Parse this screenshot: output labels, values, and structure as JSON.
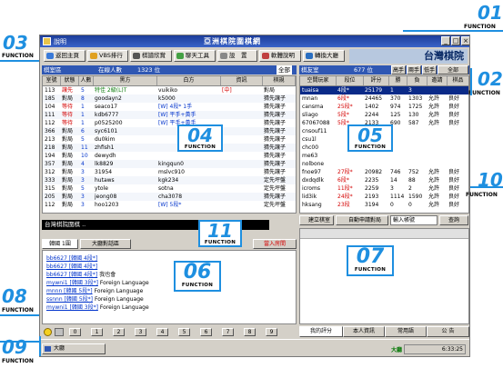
{
  "window": {
    "app_label": "說明",
    "title": "亞洲棋院圍棋網",
    "controls": [
      "_",
      "□",
      "×"
    ]
  },
  "toolbar": {
    "buttons": [
      "返回主頁",
      "VBS排行",
      "棋譜欣賞",
      "聊天工具",
      "設　置",
      "軟體說明",
      "轉換大廳"
    ],
    "logo_text": "台灣棋院"
  },
  "games": {
    "header_label": "棋室區",
    "online_label": "在線人數",
    "online_count": "1323 位",
    "filter_label": "全部",
    "columns": [
      "室號",
      "狀態",
      "人數",
      "黑方",
      "",
      "白方",
      "",
      "資訊",
      "棋規"
    ],
    "rows": [
      {
        "room": "113",
        "status": "讓先",
        "count": "5",
        "black": "特佳 2級(L)T",
        "white": "vuikiko",
        "info": "[中]",
        "rule": "對局"
      },
      {
        "room": "185",
        "status": "對局",
        "count": "8",
        "black": "goodayn2",
        "white": "k5000",
        "info": "",
        "rule": "猜先讓子"
      },
      {
        "room": "104",
        "status": "等待",
        "count": "1",
        "black": "seaco17",
        "white": "[W] 4段* 1手",
        "info": "",
        "rule": "猜先讓子"
      },
      {
        "room": "111",
        "status": "等待",
        "count": "1",
        "black": "kdb6777",
        "white": "[W] 平手+黃手",
        "info": "",
        "rule": "猜先讓子"
      },
      {
        "room": "112",
        "status": "等待",
        "count": "1",
        "black": "p0525200",
        "white": "[W] 平手+黃手",
        "info": "",
        "rule": "猜先讓子"
      },
      {
        "room": "366",
        "status": "對局",
        "count": "6",
        "black": "syc6101",
        "white": "",
        "info": "",
        "rule": "猜先讓子"
      },
      {
        "room": "213",
        "status": "對局",
        "count": "5",
        "black": "du0kim",
        "white": "",
        "info": "",
        "rule": "猜先讓子"
      },
      {
        "room": "218",
        "status": "對局",
        "count": "11",
        "black": "zhfish1",
        "white": "",
        "info": "",
        "rule": "猜先讓子"
      },
      {
        "room": "194",
        "status": "對局",
        "count": "10",
        "black": "dewydh",
        "white": "",
        "info": "",
        "rule": "猜先讓子"
      },
      {
        "room": "357",
        "status": "對局",
        "count": "4",
        "black": "lk8829",
        "white": "kingqun0",
        "info": "",
        "rule": "猜先讓子"
      },
      {
        "room": "312",
        "status": "對局",
        "count": "3",
        "black": "31954",
        "white": "mslvc910",
        "info": "",
        "rule": "猜先讓子"
      },
      {
        "room": "333",
        "status": "對局",
        "count": "3",
        "black": "hutaws",
        "white": "kgk234",
        "info": "",
        "rule": "定先坪盤"
      },
      {
        "room": "315",
        "status": "對局",
        "count": "5",
        "black": "ytole",
        "white": "sotna",
        "info": "",
        "rule": "定先坪盤"
      },
      {
        "room": "205",
        "status": "對局",
        "count": "3",
        "black": "jeong08",
        "white": "cha3078",
        "info": "",
        "rule": "猜先讓子"
      },
      {
        "room": "112",
        "status": "對局",
        "count": "3",
        "black": "hoo1203",
        "white": "[W] 5段*",
        "info": "",
        "rule": "定先坪盤"
      }
    ]
  },
  "players": {
    "header_label": "棋友室",
    "online_count": "677 位",
    "filter_label": "全部",
    "subtabs": [
      "高手",
      "兩手",
      "低手"
    ],
    "columns": [
      "空間玩家",
      "段位",
      "評分",
      "勝",
      "負",
      "邀請",
      "棋品"
    ],
    "rows": [
      {
        "name": "tuaisa",
        "rank": "4段*",
        "score": "25179",
        "win": "1",
        "loss": "3",
        "invite": "",
        "grade": ""
      },
      {
        "name": "mnan",
        "rank": "6段*",
        "score": "24465",
        "win": "370",
        "loss": "1303",
        "invite": "允許",
        "grade": "良好"
      },
      {
        "name": "cansma",
        "rank": "25段*",
        "score": "1402",
        "win": "974",
        "loss": "1725",
        "invite": "允許",
        "grade": "良好"
      },
      {
        "name": "sliago",
        "rank": "5段*",
        "score": "2244",
        "win": "125",
        "loss": "130",
        "invite": "允許",
        "grade": "良好"
      },
      {
        "name": "67067088",
        "rank": "5段*",
        "score": "2133",
        "win": "690",
        "loss": "587",
        "invite": "允許",
        "grade": "良好"
      },
      {
        "name": "cnsouf11",
        "rank": "",
        "score": "",
        "win": "",
        "loss": "",
        "invite": "",
        "grade": ""
      },
      {
        "name": "csu1l",
        "rank": "",
        "score": "",
        "win": "",
        "loss": "",
        "invite": "",
        "grade": ""
      },
      {
        "name": "chc00",
        "rank": "",
        "score": "",
        "win": "",
        "loss": "",
        "invite": "",
        "grade": ""
      },
      {
        "name": "me63",
        "rank": "",
        "score": "",
        "win": "",
        "loss": "",
        "invite": "",
        "grade": ""
      },
      {
        "name": "nolbone",
        "rank": "",
        "score": "",
        "win": "",
        "loss": "",
        "invite": "",
        "grade": ""
      },
      {
        "name": "fnoe97",
        "rank": "27段*",
        "score": "20982",
        "win": "746",
        "loss": "752",
        "invite": "允許",
        "grade": "良好"
      },
      {
        "name": "dxdqdlk",
        "rank": "6段*",
        "score": "2235",
        "win": "14",
        "loss": "88",
        "invite": "允許",
        "grade": "良好"
      },
      {
        "name": "icroms",
        "rank": "11段*",
        "score": "2259",
        "win": "3",
        "loss": "2",
        "invite": "允許",
        "grade": "良好"
      },
      {
        "name": "lid3ik",
        "rank": "24段*",
        "score": "2193",
        "win": "1114",
        "loss": "1590",
        "invite": "允許",
        "grade": "良好"
      },
      {
        "name": "hksang",
        "rank": "23段",
        "score": "3194",
        "win": "0",
        "loss": "0",
        "invite": "允許",
        "grade": "良好"
      }
    ]
  },
  "player_actions": {
    "create_room": "建立棋室",
    "auto_match": "自動申請對局",
    "search_placeholder": "輸入帳號",
    "search_button": "查詢"
  },
  "notice_bar": {
    "text": "台灣棋院圍棋 .."
  },
  "chat": {
    "tabs": [
      "韓國 1圍",
      "大廳對話區"
    ],
    "invite_label": "當入房間",
    "lines": [
      {
        "user": "bb6627 [韓國 4段*]",
        "text": ""
      },
      {
        "user": "bb6627 [韓國 4段*]",
        "text": ""
      },
      {
        "user": "bb6627 [韓國 4段*]",
        "text": "我也會"
      },
      {
        "user": "mywni1 [韓國 3段*]",
        "text": "Foreign Language"
      },
      {
        "user": "mnnn [韓國 5段*]",
        "text": "Foreign Language"
      },
      {
        "user": "ssnnn [韓國 5段*]",
        "text": "Foreign Language"
      },
      {
        "user": "mywni1 [韓國 3段*]",
        "text": "Foreign Language"
      }
    ],
    "number_buttons": [
      "0",
      "1",
      "2",
      "3",
      "4",
      "5",
      "6",
      "7",
      "8",
      "9"
    ]
  },
  "info_tabs": [
    "我的評分",
    "本人資訊",
    "常用語",
    "公 告"
  ],
  "statusbar": {
    "lobby": "大廳",
    "mode": "大廳",
    "time": "6:33:25"
  },
  "callouts": [
    {
      "num": "01",
      "label": "FUNCTION"
    },
    {
      "num": "02",
      "label": "FUNCTION"
    },
    {
      "num": "03",
      "label": "FUNCTION"
    },
    {
      "num": "04",
      "label": "FUNCTION"
    },
    {
      "num": "05",
      "label": "FUNCTION"
    },
    {
      "num": "06",
      "label": "FUNCTION"
    },
    {
      "num": "07",
      "label": "FUNCTION"
    },
    {
      "num": "08",
      "label": "FUNCTION"
    },
    {
      "num": "09",
      "label": "FUNCTION"
    },
    {
      "num": "10",
      "label": "FUNCTION"
    },
    {
      "num": "11",
      "label": "FUNCTION"
    }
  ],
  "colors": {
    "accent": "#1e8fe0",
    "title_bar": "#2f57b3",
    "status_red": "#d40000",
    "status_blue": "#0033cc"
  }
}
